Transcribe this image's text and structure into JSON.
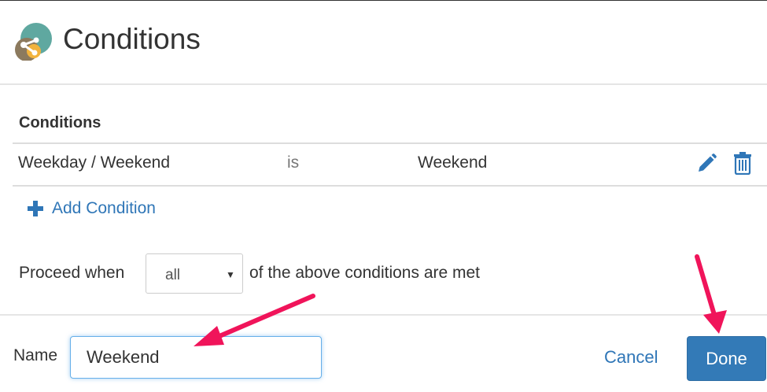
{
  "dialog": {
    "title": "Conditions",
    "logo_icon": "share-gear-icon"
  },
  "conditions": {
    "heading": "Conditions",
    "rows": [
      {
        "field": "Weekday / Weekend",
        "operator": "is",
        "value": "Weekend",
        "edit_icon": "pencil-icon",
        "delete_icon": "trash-icon"
      }
    ],
    "add_label": "Add Condition",
    "add_icon": "plus-icon"
  },
  "proceed": {
    "prefix": "Proceed when",
    "selected": "all",
    "suffix": "of the above conditions are met"
  },
  "footer": {
    "name_label": "Name",
    "name_value": "Weekend",
    "cancel_label": "Cancel",
    "done_label": "Done"
  },
  "colors": {
    "accent": "#2f76b7",
    "primary_button": "#337ab7",
    "annotation_arrow": "#f0145a"
  }
}
